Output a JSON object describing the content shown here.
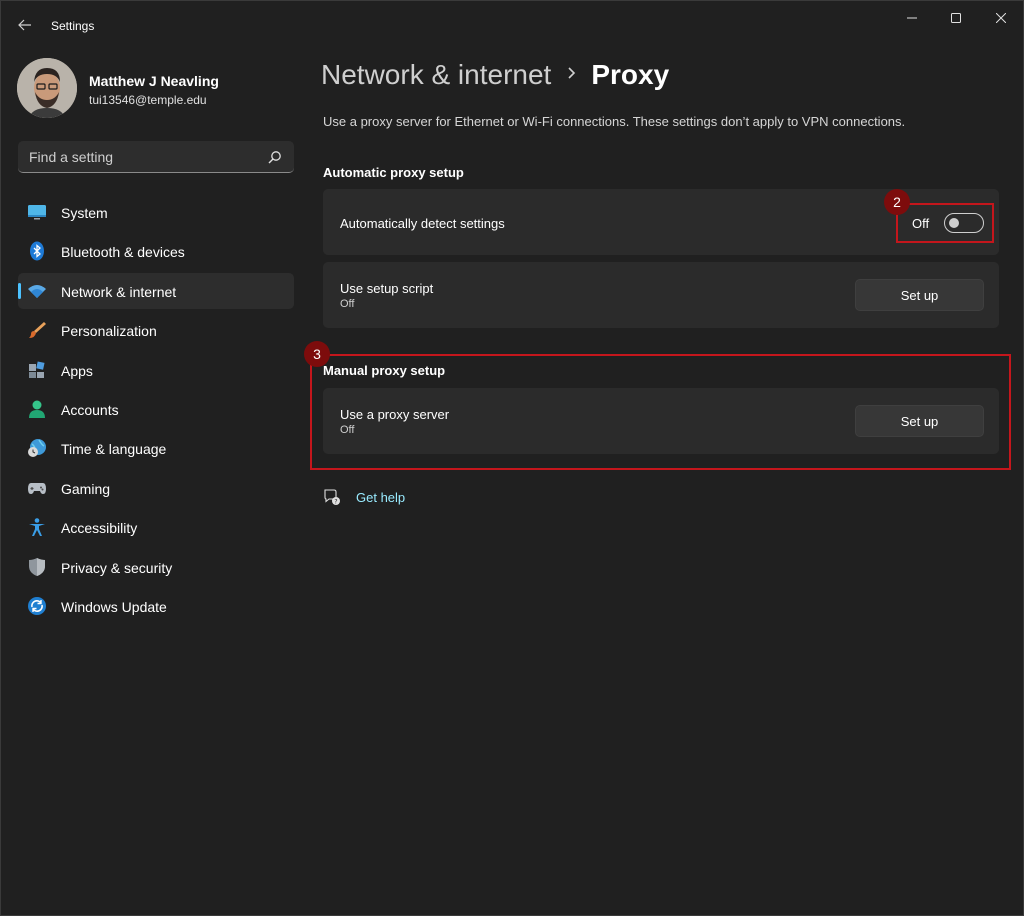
{
  "window": {
    "title": "Settings",
    "controls": {
      "minimize": "minimize-icon",
      "maximize": "maximize-icon",
      "close": "close-icon"
    }
  },
  "profile": {
    "name": "Matthew J Neavling",
    "email": "tui13546@temple.edu"
  },
  "search": {
    "placeholder": "Find a setting"
  },
  "sidebar": {
    "items": [
      {
        "label": "System",
        "icon": "monitor-icon"
      },
      {
        "label": "Bluetooth & devices",
        "icon": "bluetooth-icon"
      },
      {
        "label": "Network & internet",
        "icon": "wifi-icon",
        "selected": true
      },
      {
        "label": "Personalization",
        "icon": "paintbrush-icon"
      },
      {
        "label": "Apps",
        "icon": "apps-icon"
      },
      {
        "label": "Accounts",
        "icon": "person-icon"
      },
      {
        "label": "Time & language",
        "icon": "globe-clock-icon"
      },
      {
        "label": "Gaming",
        "icon": "gamepad-icon"
      },
      {
        "label": "Accessibility",
        "icon": "accessibility-icon"
      },
      {
        "label": "Privacy & security",
        "icon": "shield-icon"
      },
      {
        "label": "Windows Update",
        "icon": "refresh-icon"
      }
    ]
  },
  "breadcrumb": {
    "parent": "Network & internet",
    "separator": ">",
    "current": "Proxy"
  },
  "content": {
    "description": "Use a proxy server for Ethernet or Wi-Fi connections. These settings don’t apply to VPN connections.",
    "automatic": {
      "section_title": "Automatic proxy setup",
      "detect": {
        "title": "Automatically detect settings",
        "toggle_label": "Off",
        "toggle_on": false
      },
      "script": {
        "title": "Use setup script",
        "status": "Off",
        "button": "Set up"
      }
    },
    "manual": {
      "section_title": "Manual proxy setup",
      "proxy": {
        "title": "Use a proxy server",
        "status": "Off",
        "button": "Set up"
      }
    },
    "help": {
      "label": "Get help"
    }
  },
  "annotations": {
    "badge_toggle": "2",
    "badge_manual": "3",
    "color": "#c4161c"
  },
  "colors": {
    "accent": "#4cc2ff",
    "link": "#99ebff",
    "background": "#202020",
    "card": "#2b2b2b"
  }
}
